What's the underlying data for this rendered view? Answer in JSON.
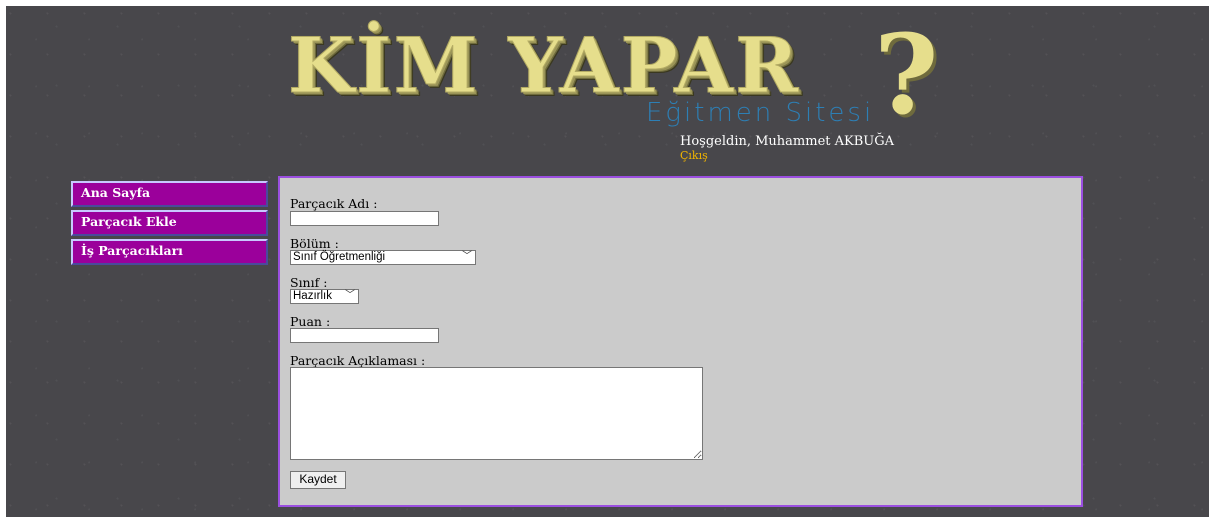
{
  "header": {
    "logo_text": "KİM YAPAR",
    "logo_question": "?",
    "logo_subtitle": "Eğitmen Sitesi",
    "welcome": "Hoşgeldin, Muhammet AKBUĞA",
    "logout": "Çıkış"
  },
  "sidebar": {
    "items": [
      {
        "label": "Ana Sayfa"
      },
      {
        "label": "Parçacık Ekle"
      },
      {
        "label": "İş Parçacıkları"
      }
    ]
  },
  "form": {
    "name_label": "Parçacık Adı :",
    "name_value": "",
    "dept_label": "Bölüm :",
    "dept_selected": "Sınıf Öğretmenliği",
    "class_label": "Sınıf :",
    "class_selected": "Hazırlık",
    "score_label": "Puan :",
    "score_value": "",
    "desc_label": "Parçacık Açıklaması :",
    "desc_value": "",
    "save_label": "Kaydet"
  },
  "icons": {
    "select_chevron": "chevron-down-icon"
  },
  "colors": {
    "background": "#48474b",
    "sidebar_item": "#9b009b",
    "content_bg": "#cbcbcb",
    "content_border": "#9b4fe0",
    "logout_link": "#f0b400",
    "logo_fill": "#e6de8c",
    "logo_subtitle": "#2d7fb5"
  }
}
